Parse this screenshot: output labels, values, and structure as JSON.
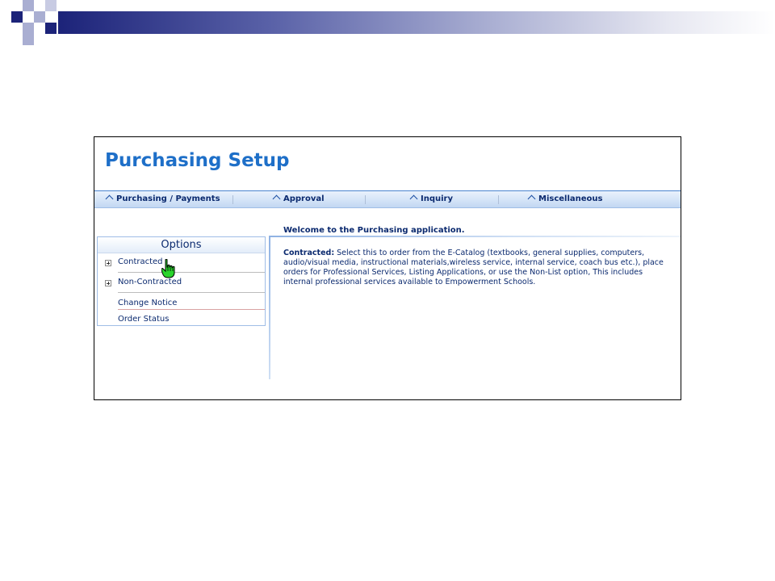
{
  "app": {
    "title": "Purchasing Setup"
  },
  "nav": {
    "items": [
      {
        "label": "Purchasing / Payments",
        "icon": "chevron-up-icon"
      },
      {
        "label": "Approval",
        "icon": "chevron-up-icon"
      },
      {
        "label": "Inquiry",
        "icon": "chevron-up-icon"
      },
      {
        "label": "Miscellaneous",
        "icon": "chevron-up-icon"
      }
    ]
  },
  "options": {
    "heading": "Options",
    "items": [
      {
        "label": "Contracted",
        "expander": "plus-icon"
      },
      {
        "label": "Non-Contracted",
        "expander": "plus-icon"
      },
      {
        "label": "Change Notice"
      },
      {
        "label": "Order Status"
      }
    ]
  },
  "content": {
    "welcome": "Welcome to the Purchasing application.",
    "desc_label": "Contracted:",
    "desc_text": " Select this to order from the E-Catalog (textbooks, general supplies, computers, audio/visual media, instructional materials,wireless service, internal service, coach bus etc.), place orders for Professional Services, Listing Applications, or use the Non-List option, This includes internal professional services available to Empowerment Schools."
  },
  "colors": {
    "title": "#1e6fc8",
    "nav_text": "#0b2a6f",
    "deco_dark": "#1c2379",
    "deco_light": "#a9aed2"
  },
  "cursor": {
    "icon": "hand-pointer-icon"
  }
}
